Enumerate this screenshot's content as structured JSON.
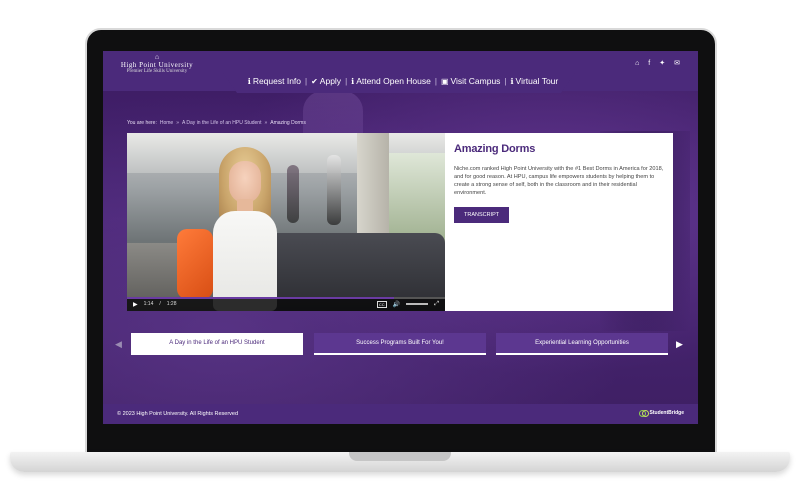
{
  "header": {
    "logo": {
      "name": "High Point University",
      "tagline": "Premier Life Skills University"
    },
    "nav": [
      {
        "icon": "info-icon",
        "label": "Request Info"
      },
      {
        "icon": "check-circle-icon",
        "label": "Apply"
      },
      {
        "icon": "info-icon",
        "label": "Attend Open House"
      },
      {
        "icon": "briefcase-icon",
        "label": "Visit Campus"
      },
      {
        "icon": "info-icon",
        "label": "Virtual Tour"
      }
    ],
    "social": [
      "home-icon",
      "facebook-icon",
      "twitter-icon",
      "mail-icon"
    ]
  },
  "breadcrumb": {
    "prefix": "You are here:",
    "items": [
      "Home",
      "A Day in the Life of an HPU Student",
      "Amazing Dorms"
    ]
  },
  "video": {
    "current_time": "1:14",
    "separator": "/",
    "duration": "1:28",
    "progress": 0.84,
    "cc_label": "CC"
  },
  "info": {
    "title": "Amazing Dorms",
    "body": "Niche.com ranked High Point University with the #1 Best Dorms in America for 2018, and for good reason. At HPU, campus life empowers students by helping them to create a strong sense of self, both in the classroom and in their residential environment.",
    "button_label": "TRANSCRIPT"
  },
  "carousel": {
    "slides": [
      "A Day in the Life of an HPU Student",
      "Success Programs Built For You!",
      "Experiential Learning Opportunities"
    ],
    "active_index": 0
  },
  "footer": {
    "copyright": "© 2023 High Point University. All Rights Reserved",
    "brand": "StudentBridge"
  },
  "colors": {
    "brand_purple": "#4b2a7b",
    "slide_purple": "#5c3790",
    "studentbridge_green": "#8fd14f"
  }
}
